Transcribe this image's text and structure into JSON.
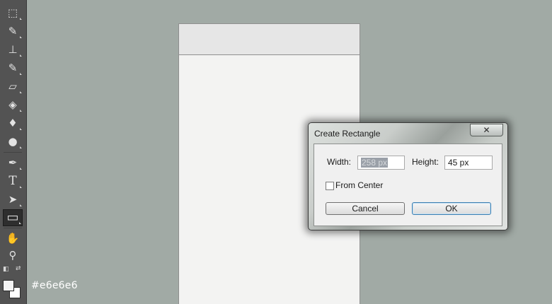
{
  "toolbar": {
    "tools": [
      {
        "name": "marquee-tool",
        "glyph": "⬚"
      },
      {
        "name": "brush-tool",
        "glyph": "✎"
      },
      {
        "name": "stamp-tool",
        "glyph": "⊥"
      },
      {
        "name": "history-brush-tool",
        "glyph": "✎"
      },
      {
        "name": "eraser-tool",
        "glyph": "▱"
      },
      {
        "name": "paint-bucket-tool",
        "glyph": "◈"
      },
      {
        "name": "blur-tool",
        "glyph": "♦"
      },
      {
        "name": "dodge-tool",
        "glyph": "●"
      },
      {
        "name": "pen-tool",
        "glyph": "✒"
      },
      {
        "name": "type-tool",
        "glyph": "T"
      },
      {
        "name": "path-selection-tool",
        "glyph": "➤"
      },
      {
        "name": "rectangle-tool",
        "glyph": "▭"
      },
      {
        "name": "hand-tool",
        "glyph": "✋"
      },
      {
        "name": "zoom-tool",
        "glyph": "⚲"
      }
    ],
    "foreground_color": "#f3f3f3",
    "background_color": "#ffffff"
  },
  "color_hex_label": "#e6e6e6",
  "dialog": {
    "title": "Create Rectangle",
    "close_glyph": "✕",
    "width_label": "Width:",
    "width_value": "258 px",
    "height_label": "Height:",
    "height_value": "45 px",
    "from_center_label": "From Center",
    "from_center_checked": false,
    "cancel_label": "Cancel",
    "ok_label": "OK"
  },
  "colors": {
    "canvas_bg": "#a1aaa5",
    "toolbar_bg": "#535353",
    "document_bg": "#f3f3f2",
    "document_header": "#e6e6e6"
  }
}
